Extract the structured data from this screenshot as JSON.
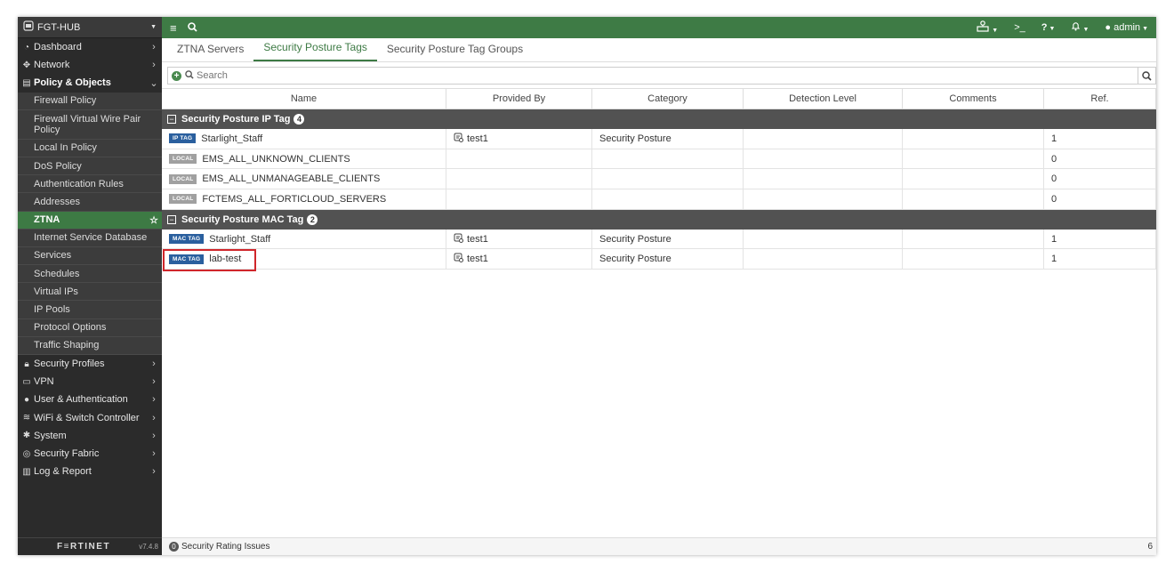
{
  "device": {
    "hostname": "FGT-HUB"
  },
  "topbar": {
    "user": "admin"
  },
  "sidebar": {
    "items_top": [
      {
        "label": "Dashboard",
        "icon": "dashboard-icon"
      },
      {
        "label": "Network",
        "icon": "network-icon"
      },
      {
        "label": "Policy & Objects",
        "icon": "policy-icon"
      }
    ],
    "policy_sub": [
      "Firewall Policy",
      "Firewall Virtual Wire Pair Policy",
      "Local In Policy",
      "DoS Policy",
      "Authentication Rules",
      "Addresses",
      "ZTNA",
      "Internet Service Database",
      "Services",
      "Schedules",
      "Virtual IPs",
      "IP Pools",
      "Protocol Options",
      "Traffic Shaping"
    ],
    "items_bottom": [
      {
        "label": "Security Profiles",
        "icon": "lock-icon"
      },
      {
        "label": "VPN",
        "icon": "laptop-icon"
      },
      {
        "label": "User & Authentication",
        "icon": "user-icon"
      },
      {
        "label": "WiFi & Switch Controller",
        "icon": "wifi-icon"
      },
      {
        "label": "System",
        "icon": "gear-icon"
      },
      {
        "label": "Security Fabric",
        "icon": "fabric-icon"
      },
      {
        "label": "Log & Report",
        "icon": "chart-icon"
      }
    ],
    "logo": "F≡RTINET",
    "version": "v7.4.8"
  },
  "tabs": [
    "ZTNA Servers",
    "Security Posture Tags",
    "Security Posture Tag Groups"
  ],
  "search": {
    "placeholder": "Search"
  },
  "columns": [
    "Name",
    "Provided By",
    "Category",
    "Detection Level",
    "Comments",
    "Ref."
  ],
  "groups": [
    {
      "title": "Security Posture IP Tag",
      "count": "4",
      "rows": [
        {
          "badge": "IP TAG",
          "badge_type": "ip",
          "name": "Starlight_Staff",
          "provided_by": "test1",
          "category": "Security Posture",
          "detection": "",
          "comments": "",
          "ref": "1"
        },
        {
          "badge": "LOCAL",
          "badge_type": "local",
          "name": "EMS_ALL_UNKNOWN_CLIENTS",
          "provided_by": "",
          "category": "",
          "detection": "",
          "comments": "",
          "ref": "0"
        },
        {
          "badge": "LOCAL",
          "badge_type": "local",
          "name": "EMS_ALL_UNMANAGEABLE_CLIENTS",
          "provided_by": "",
          "category": "",
          "detection": "",
          "comments": "",
          "ref": "0"
        },
        {
          "badge": "LOCAL",
          "badge_type": "local",
          "name": "FCTEMS_ALL_FORTICLOUD_SERVERS",
          "provided_by": "",
          "category": "",
          "detection": "",
          "comments": "",
          "ref": "0"
        }
      ]
    },
    {
      "title": "Security Posture MAC Tag",
      "count": "2",
      "rows": [
        {
          "badge": "MAC TAG",
          "badge_type": "mac",
          "name": "Starlight_Staff",
          "provided_by": "test1",
          "category": "Security Posture",
          "detection": "",
          "comments": "",
          "ref": "1"
        },
        {
          "badge": "MAC TAG",
          "badge_type": "mac",
          "name": "lab-test",
          "provided_by": "test1",
          "category": "Security Posture",
          "detection": "",
          "comments": "",
          "ref": "1"
        }
      ]
    }
  ],
  "status": {
    "issues_count": "0",
    "issues_label": "Security Rating Issues",
    "row_count": "6"
  },
  "colors": {
    "accent": "#3d7a44",
    "highlight": "#d0262b",
    "group_bg": "#525252"
  }
}
